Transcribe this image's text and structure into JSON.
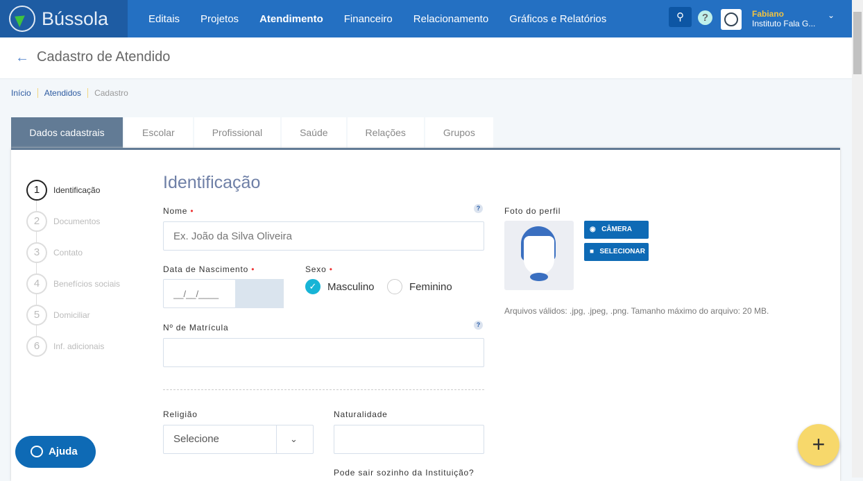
{
  "app": {
    "name": "Bússola"
  },
  "nav": [
    "Editais",
    "Projetos",
    "Atendimento",
    "Financeiro",
    "Relacionamento",
    "Gráficos e Relatórios"
  ],
  "nav_active": "Atendimento",
  "user": {
    "name": "Fabiano",
    "org": "Instituto Fala G..."
  },
  "page": {
    "title": "Cadastro de Atendido"
  },
  "breadcrumb": [
    "Início",
    "Atendidos",
    "Cadastro"
  ],
  "tabs": [
    "Dados cadastrais",
    "Escolar",
    "Profissional",
    "Saúde",
    "Relações",
    "Grupos"
  ],
  "steps": [
    {
      "n": "1",
      "label": "Identificação"
    },
    {
      "n": "2",
      "label": "Documentos"
    },
    {
      "n": "3",
      "label": "Contato"
    },
    {
      "n": "4",
      "label": "Benefícios sociais"
    },
    {
      "n": "5",
      "label": "Domiciliar"
    },
    {
      "n": "6",
      "label": "Inf. adicionais"
    }
  ],
  "form": {
    "section_title": "Identificação",
    "nome_label": "Nome",
    "nome_placeholder": "Ex. João da Silva Oliveira",
    "nasc_label": "Data de Nascimento",
    "nasc_placeholder": "__/__/____",
    "sexo_label": "Sexo",
    "sexo_options": [
      "Masculino",
      "Feminino"
    ],
    "sexo_selected": "Masculino",
    "matricula_label": "Nº de Matrícula",
    "religiao_label": "Religião",
    "religiao_value": "Selecione",
    "naturalidade_label": "Naturalidade",
    "sair_label": "Pode sair sozinho da Instituição?",
    "required_mark": "•",
    "help_mark": "?"
  },
  "photo": {
    "label": "Foto do perfil",
    "camera": "CÂMERA",
    "select": "SELECIONAR",
    "note": "Arquivos válidos: .jpg, .jpeg, .png. Tamanho máximo do arquivo: 20 MB."
  },
  "help_button": "Ajuda",
  "fab": "+",
  "colors": {
    "topbar": "#2470c2",
    "accent": "#0e6ab5",
    "tab_active": "#627b95",
    "radio": "#17b4d6",
    "fab": "#f7d86b"
  }
}
